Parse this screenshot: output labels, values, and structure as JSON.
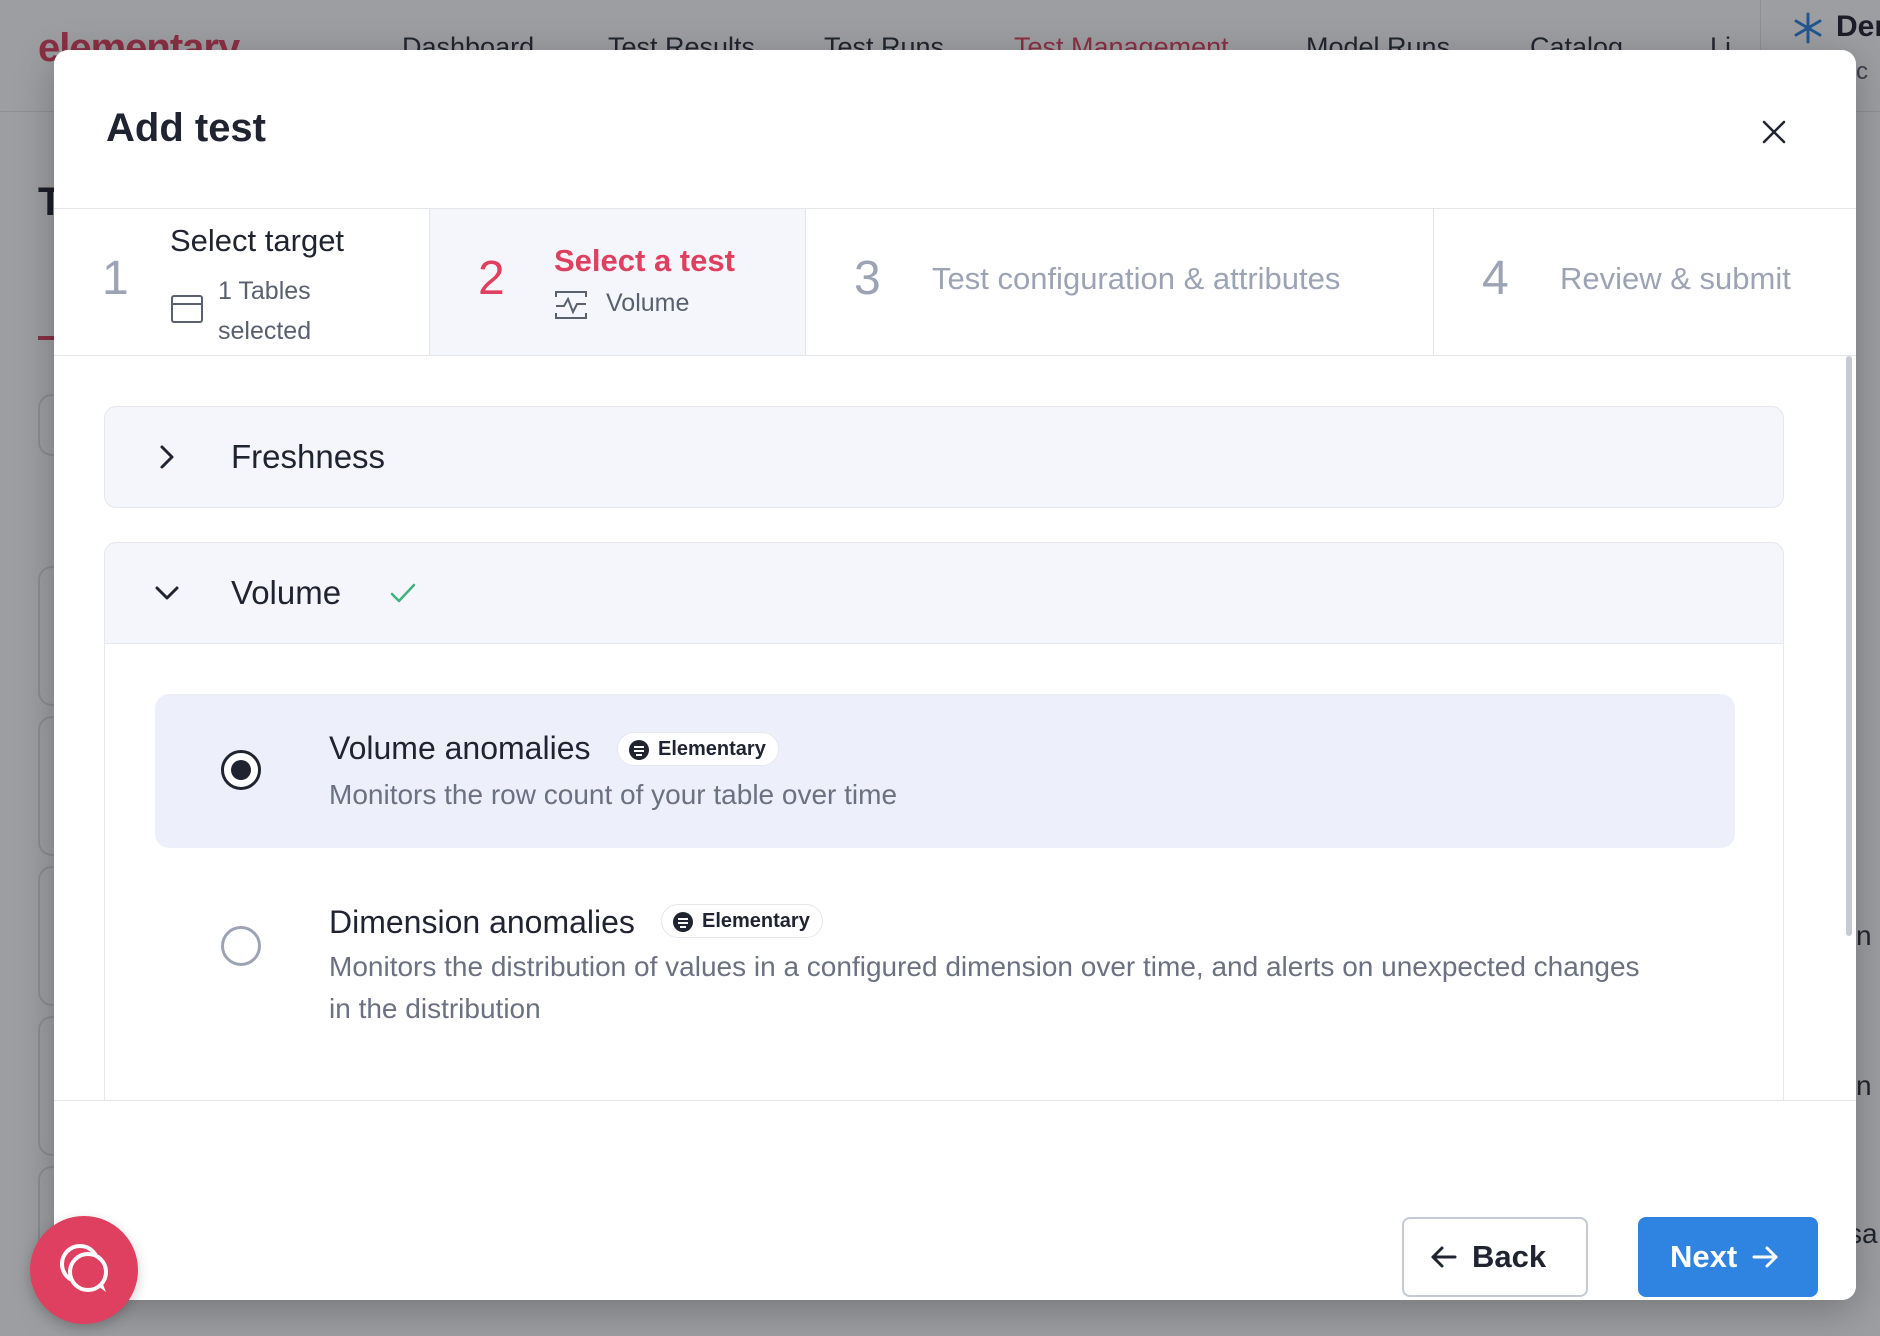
{
  "background": {
    "logo": "elementary",
    "nav": [
      "Dashboard",
      "Test Results",
      "Test Runs",
      "Test Management",
      "Model Runs",
      "Catalog",
      "Li"
    ],
    "active_nav": "Test Management",
    "env_title": "Der",
    "env_sub": "tec",
    "page_title_initial": "T",
    "row_fragments": [
      "n",
      "n",
      "sa"
    ]
  },
  "modal": {
    "title": "Add test",
    "close_icon": "close-icon",
    "steps": [
      {
        "number": "1",
        "label": "Select target",
        "sub": "1 Tables selected",
        "icon": "table-icon",
        "state": "done"
      },
      {
        "number": "2",
        "label": "Select a test",
        "sub": "Volume",
        "icon": "volume-chart-icon",
        "state": "active"
      },
      {
        "number": "3",
        "label": "Test configuration & attributes",
        "state": "pending"
      },
      {
        "number": "4",
        "label": "Review & submit",
        "state": "pending"
      }
    ],
    "categories": [
      {
        "title": "Freshness",
        "expanded": false,
        "icon": "chevron-right-icon"
      },
      {
        "title": "Volume",
        "expanded": true,
        "icon": "chevron-down-icon",
        "check_icon": "check-icon"
      }
    ],
    "options": [
      {
        "title": "Volume anomalies",
        "badge": "Elementary",
        "description": "Monitors the row count of your table over time",
        "selected": true
      },
      {
        "title": "Dimension anomalies",
        "badge": "Elementary",
        "description": "Monitors the distribution of values in a configured dimension over time, and alerts on unexpected changes in the distribution",
        "selected": false
      }
    ],
    "buttons": {
      "back": "Back",
      "next": "Next"
    }
  },
  "colors": {
    "accent": "#e0405f",
    "primary": "#2e84e0",
    "selected_bg": "#edf0fb",
    "success": "#3fb27f"
  }
}
